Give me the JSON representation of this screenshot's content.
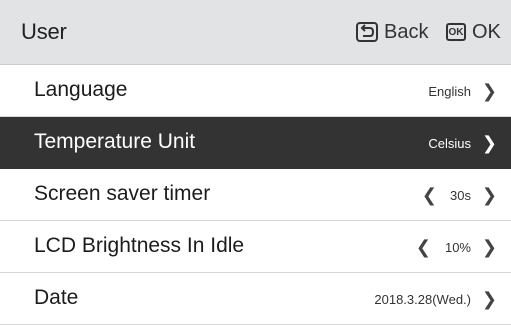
{
  "header": {
    "title": "User",
    "back_label": "Back",
    "ok_icon_text": "OK",
    "ok_label": "OK"
  },
  "menu": {
    "items": [
      {
        "label": "Language",
        "value": "English",
        "selected": false,
        "has_left_arrow": false
      },
      {
        "label": "Temperature Unit",
        "value": "Celsius",
        "selected": true,
        "has_left_arrow": false
      },
      {
        "label": "Screen saver timer",
        "value": "30s",
        "selected": false,
        "has_left_arrow": true
      },
      {
        "label": "LCD Brightness In Idle",
        "value": "10%",
        "selected": false,
        "has_left_arrow": true
      },
      {
        "label": "Date",
        "value": "2018.3.28(Wed.)",
        "selected": false,
        "has_left_arrow": false
      }
    ]
  },
  "icons": {
    "back": "back-arrow-icon",
    "ok": "ok-key-icon",
    "right": "chevron-right-icon",
    "left": "chevron-left-icon"
  },
  "colors": {
    "header_bg": "#e2e3e5",
    "selected_bg": "#333333",
    "row_bg": "#ffffff"
  }
}
